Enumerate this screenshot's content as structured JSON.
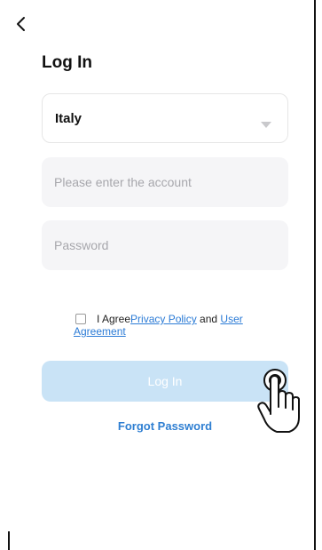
{
  "header": {
    "title": "Log In"
  },
  "country": {
    "value": "Italy"
  },
  "account": {
    "placeholder": "Please enter the account",
    "value": ""
  },
  "password": {
    "placeholder": "Password",
    "value": ""
  },
  "agreement": {
    "checked": false,
    "prefix": "I Agree",
    "privacy_link": "Privacy Policy",
    "and": " and ",
    "user_link": "User Agreement"
  },
  "login_button": {
    "label": "Log In"
  },
  "forgot_link": {
    "label": "Forgot Password"
  },
  "colors": {
    "accent": "#2f7fd2",
    "button_disabled": "#c9e3f6",
    "input_bg": "#f5f5f7",
    "placeholder": "#a7a7ac"
  },
  "icons": [
    "back-arrow-icon",
    "dropdown-caret-icon",
    "pointing-hand-icon"
  ]
}
